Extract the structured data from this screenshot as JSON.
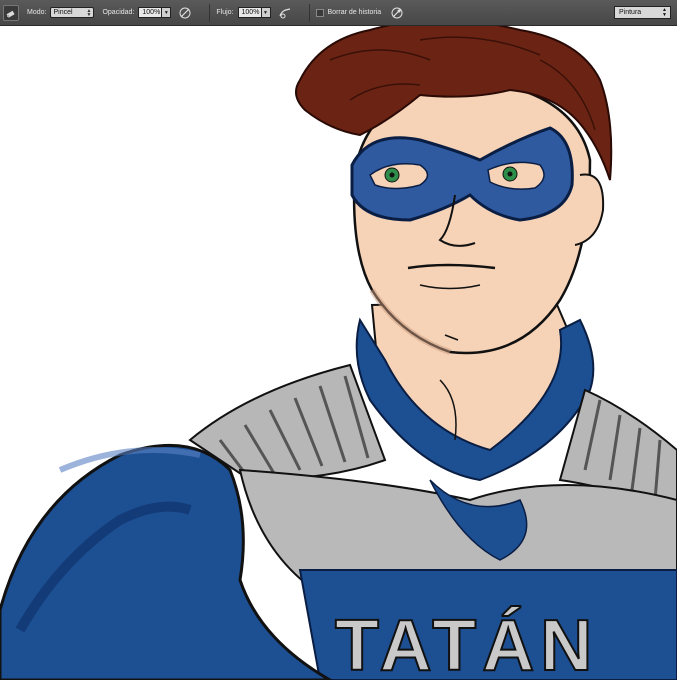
{
  "options_bar": {
    "mode_label": "Modo:",
    "mode_value": "Pincel",
    "opacity_label": "Opacidad:",
    "opacity_value": "100%",
    "flow_label": "Flujo:",
    "flow_value": "100%",
    "history_label": "Borrar de historia",
    "workspace_value": "Pintura"
  },
  "artwork": {
    "chest_lettering": "TATÁN",
    "colors": {
      "suit_blue": "#1d4f93",
      "suit_dark": "#0d2f66",
      "armor_gray": "#b7b7b7",
      "armor_shadow": "#6f6f6f",
      "skin": "#f6d2b6",
      "hair": "#6b2414",
      "mask": "#2f5aa0",
      "eyes": "#2f8f4a"
    }
  }
}
